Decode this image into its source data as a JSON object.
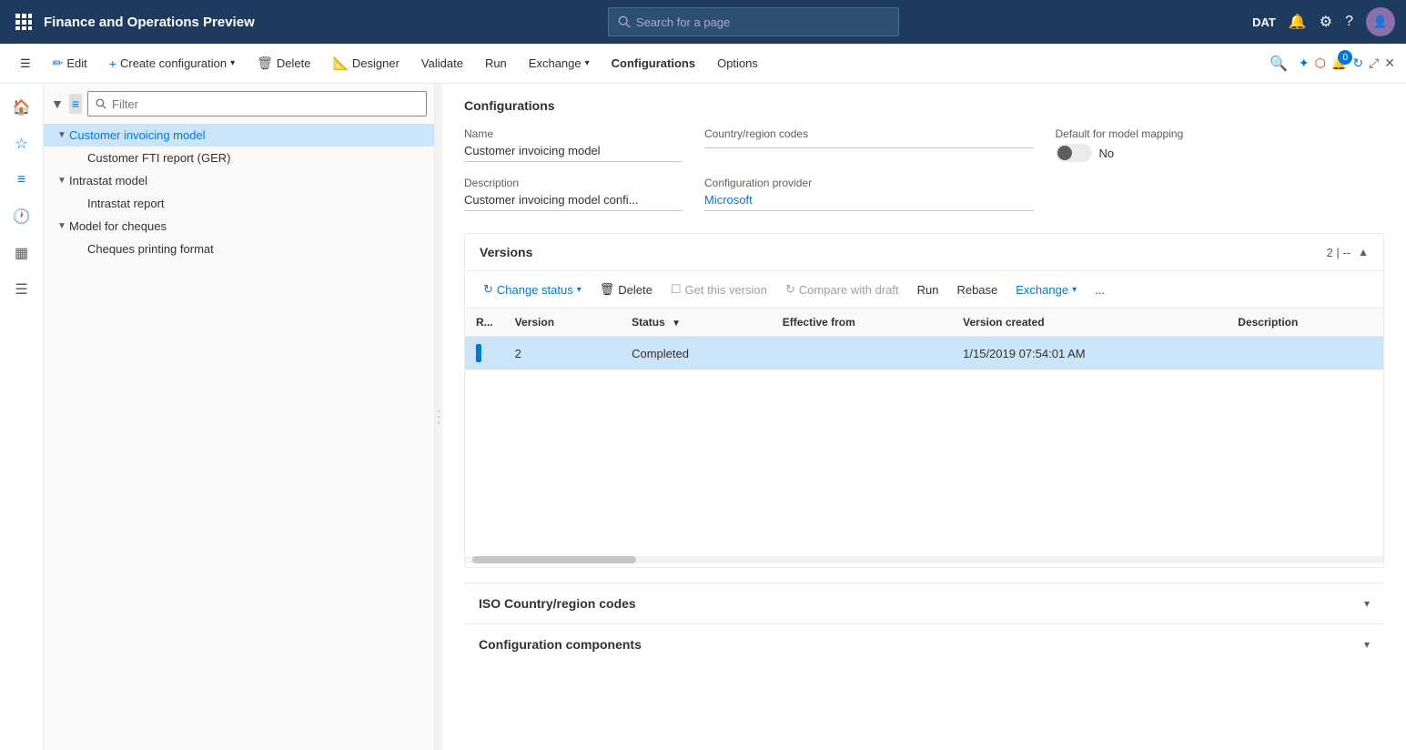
{
  "app": {
    "title": "Finance and Operations Preview",
    "env": "DAT"
  },
  "search": {
    "placeholder": "Search for a page"
  },
  "cmdbar": {
    "edit": "Edit",
    "create_config": "Create configuration",
    "delete": "Delete",
    "designer": "Designer",
    "validate": "Validate",
    "run": "Run",
    "exchange": "Exchange",
    "configurations": "Configurations",
    "options": "Options"
  },
  "sidebar": {
    "filter_placeholder": "Filter",
    "items": [
      {
        "label": "Customer invoicing model",
        "level": 0,
        "expandable": true,
        "expanded": true,
        "selected": true
      },
      {
        "label": "Customer FTI report (GER)",
        "level": 1,
        "expandable": false
      },
      {
        "label": "Intrastat model",
        "level": 0,
        "expandable": true,
        "expanded": true
      },
      {
        "label": "Intrastat report",
        "level": 1,
        "expandable": false
      },
      {
        "label": "Model for cheques",
        "level": 0,
        "expandable": true,
        "expanded": true
      },
      {
        "label": "Cheques printing format",
        "level": 1,
        "expandable": false
      }
    ]
  },
  "configurations": {
    "page_title": "Configurations",
    "name_label": "Name",
    "name_value": "Customer invoicing model",
    "country_label": "Country/region codes",
    "country_value": "",
    "default_label": "Default for model mapping",
    "default_toggle": "No",
    "description_label": "Description",
    "description_value": "Customer invoicing model confi...",
    "provider_label": "Configuration provider",
    "provider_value": "Microsoft"
  },
  "versions": {
    "title": "Versions",
    "count": "2",
    "separator": "--",
    "toolbar": {
      "change_status": "Change status",
      "delete": "Delete",
      "get_this_version": "Get this version",
      "compare_with_draft": "Compare with draft",
      "run": "Run",
      "rebase": "Rebase",
      "exchange": "Exchange",
      "more": "..."
    },
    "columns": {
      "r": "R...",
      "version": "Version",
      "status": "Status",
      "effective_from": "Effective from",
      "version_created": "Version created",
      "description": "Description"
    },
    "rows": [
      {
        "indicator": true,
        "version": "2",
        "status": "Completed",
        "effective_from": "",
        "version_created": "1/15/2019 07:54:01 AM",
        "description": "",
        "selected": true
      }
    ]
  },
  "iso_section": {
    "title": "ISO Country/region codes"
  },
  "config_components": {
    "title": "Configuration components"
  }
}
